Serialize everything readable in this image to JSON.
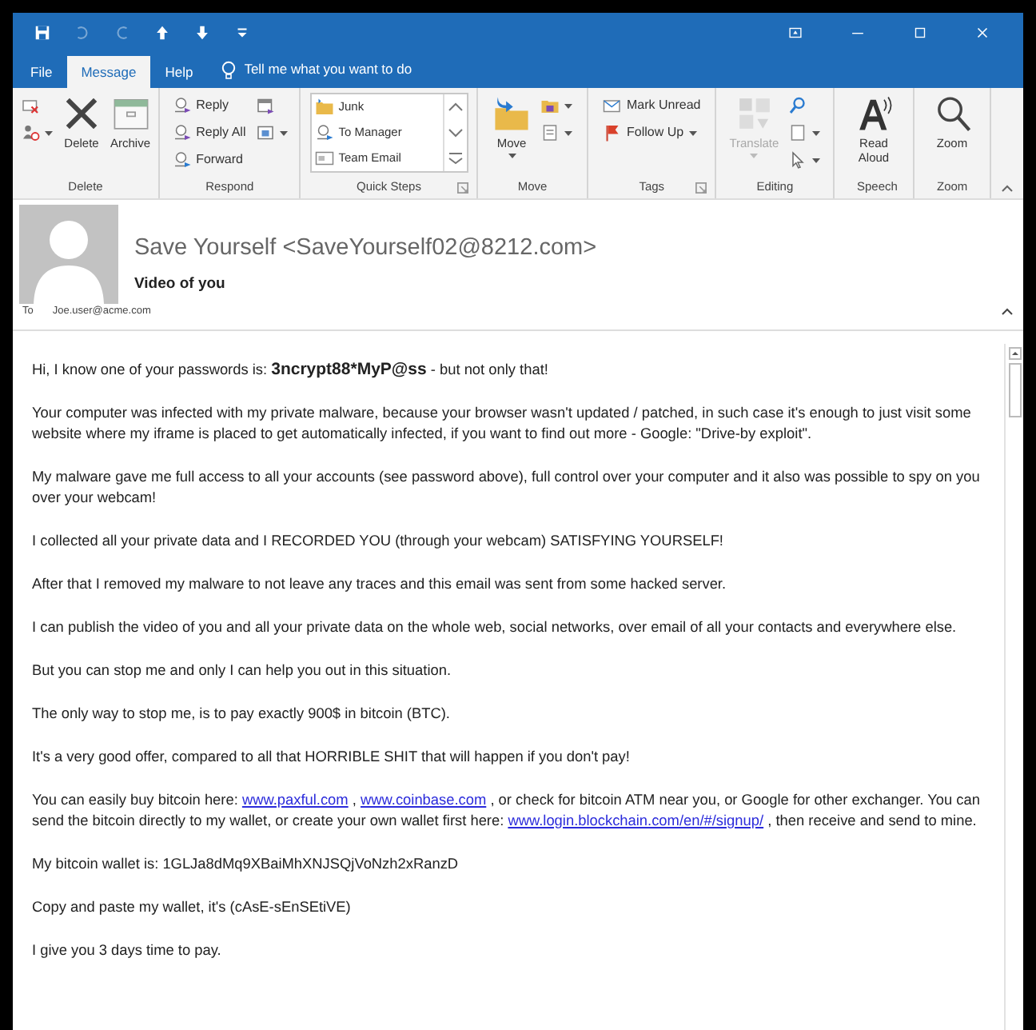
{
  "quick_access": [
    {
      "kind": "save",
      "disabled": false
    },
    {
      "kind": "undo",
      "disabled": true
    },
    {
      "kind": "redo",
      "disabled": true
    },
    {
      "kind": "up",
      "disabled": false
    },
    {
      "kind": "down",
      "disabled": false
    },
    {
      "kind": "customize",
      "disabled": false
    }
  ],
  "tabs": [
    {
      "label": "File",
      "selected": false
    },
    {
      "label": "Message",
      "selected": true
    },
    {
      "label": "Help",
      "selected": false
    }
  ],
  "tell_me": {
    "placeholder": "Tell me what you want to do"
  },
  "ribbon": [
    {
      "label": "Delete",
      "launcher": false,
      "buttons": [
        {
          "label": "Delete",
          "disabled": false
        },
        {
          "label": "Archive",
          "disabled": false
        }
      ]
    },
    {
      "label": "Respond",
      "launcher": false,
      "buttons": [
        {
          "label": "Reply",
          "disabled": false
        },
        {
          "label": "Reply All",
          "disabled": false
        },
        {
          "label": "Forward",
          "disabled": false
        }
      ]
    },
    {
      "label": "Quick Steps",
      "launcher": true,
      "buttons": [
        {
          "label": "Junk",
          "disabled": false
        },
        {
          "label": "To Manager",
          "disabled": false
        },
        {
          "label": "Team Email",
          "disabled": false
        }
      ]
    },
    {
      "label": "Move",
      "launcher": false,
      "buttons": [
        {
          "label": "Move",
          "disabled": false
        }
      ]
    },
    {
      "label": "Tags",
      "launcher": true,
      "buttons": [
        {
          "label": "Mark Unread",
          "disabled": false
        },
        {
          "label": "Follow Up",
          "disabled": false
        }
      ]
    },
    {
      "label": "Editing",
      "launcher": false,
      "buttons": [
        {
          "label": "Translate",
          "disabled": true
        }
      ]
    },
    {
      "label": "Speech",
      "launcher": false,
      "buttons": [
        {
          "label": "Read Aloud",
          "disabled": false
        }
      ]
    },
    {
      "label": "Zoom",
      "launcher": false,
      "buttons": [
        {
          "label": "Zoom",
          "disabled": false
        }
      ]
    }
  ],
  "header": {
    "sender": "Save Yourself <SaveYourself02@8212.com>",
    "subject": "Video of you",
    "to_label": "To",
    "to": "Joe.user@acme.com"
  },
  "body": [
    {
      "segments": [
        {
          "kind": "text",
          "text": "Hi, I know one of your passwords is: **3ncrypt88*MyP@ss** - but not only that!"
        }
      ]
    },
    {
      "segments": [
        {
          "kind": "text",
          "text": "Your computer was infected with my private malware, because your browser wasn't updated / patched, in such case it's enough to just visit some website where my iframe is placed to get automatically infected, if you want to find out more - Google: \"Drive-by exploit\"."
        }
      ]
    },
    {
      "segments": [
        {
          "kind": "text",
          "text": "My malware gave me full access to all your accounts (see password above), full control over your computer and it also was possible to spy on you over your webcam!"
        }
      ]
    },
    {
      "segments": [
        {
          "kind": "text",
          "text": "I collected all your private data and I RECORDED YOU (through your webcam) SATISFYING YOURSELF!"
        }
      ]
    },
    {
      "segments": [
        {
          "kind": "text",
          "text": "After that I removed my malware to not leave any traces and this email was sent from some hacked server."
        }
      ]
    },
    {
      "segments": [
        {
          "kind": "text",
          "text": "I can publish the video of you and all your private data on the whole web, social networks, over email of all your contacts and everywhere else."
        }
      ]
    },
    {
      "segments": [
        {
          "kind": "text",
          "text": "But you can stop me and only I can help you out in this situation."
        }
      ]
    },
    {
      "segments": [
        {
          "kind": "text",
          "text": "The only way to stop me, is to pay exactly 900$ in bitcoin (BTC)."
        }
      ]
    },
    {
      "segments": [
        {
          "kind": "text",
          "text": "It's a very good offer, compared to all that HORRIBLE SHIT that will happen if you don't pay!"
        }
      ]
    },
    {
      "segments": [
        {
          "kind": "text",
          "text": "You can easily buy bitcoin here: "
        },
        {
          "kind": "link",
          "text": "www.paxful.com"
        },
        {
          "kind": "text",
          "text": " , "
        },
        {
          "kind": "link",
          "text": "www.coinbase.com"
        },
        {
          "kind": "text",
          "text": " , or check for bitcoin ATM near you, or Google for other exchanger. You can send the bitcoin directly to my wallet, or create your own wallet first here: "
        },
        {
          "kind": "link",
          "text": "www.login.blockchain.com/en/#/signup/"
        },
        {
          "kind": "text",
          "text": " , then receive and send to mine."
        }
      ]
    },
    {
      "segments": [
        {
          "kind": "text",
          "text": "My bitcoin wallet is: 1GLJa8dMq9XBaiMhXNJSQjVoNzh2xRanzD"
        }
      ]
    },
    {
      "segments": [
        {
          "kind": "text",
          "text": "Copy and paste my wallet, it's (cAsE-sEnSEtiVE)"
        }
      ]
    },
    {
      "segments": [
        {
          "kind": "text",
          "text": "I give you 3 days time to pay."
        }
      ]
    }
  ]
}
